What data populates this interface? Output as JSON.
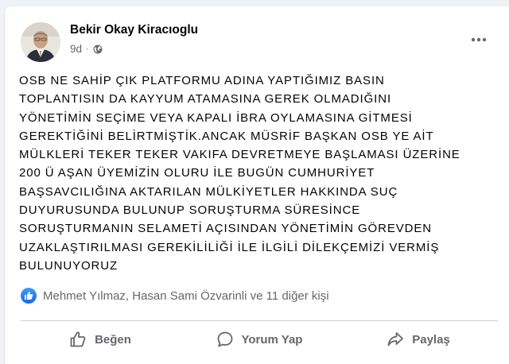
{
  "post": {
    "author_name": "Bekir Okay Kiracıoglu",
    "time": "9d",
    "dot": "·",
    "text_lines": [
      "OSB NE SAHİP ÇIK PLATFORMU ADINA YAPTIĞIMIZ BASIN",
      "TOPLANTISIN DA KAYYUM ATAMASINA GEREK OLMADIĞINI",
      "YÖNETİMİN SEÇİME VEYA KAPALI İBRA OYLAMASINA GİTMESİ",
      "GEREKTİĞİNİ BELİRTMİŞTİK.ANCAK MÜSRİF BAŞKAN OSB YE AİT",
      "MÜLKLERİ TEKER TEKER VAKIFA DEVRETMEYE BAŞLAMASI  ÜZERİNE",
      "200 Ü AŞAN ÜYEMİZİN OLURU İLE BUGÜN CUMHURİYET",
      "BAŞSAVCILIĞINA AKTARILAN MÜLKİYETLER HAKKINDA SUÇ",
      "DUYURUSUNDA BULUNUP SORUŞTURMA SÜRESİNCE",
      "SORUŞTURMANIN SELAMETİ AÇISINDAN YÖNETİMİN GÖREVDEN",
      "UZAKLAŞTIRILMASI GEREKİLİLİĞİ  İLE İLGİLİ DİLEKÇEMİZİ VERMİŞ",
      "BULUNUYORUZ"
    ],
    "reactions_text": "Mehmet Yılmaz, Hasan Sami Özvarinli ve 11 diğer kişi"
  },
  "actions": {
    "like_label": "Beğen",
    "comment_label": "Yorum Yap",
    "share_label": "Paylaş"
  },
  "icons": {
    "privacy": "globe-icon",
    "more": "more-options-icon",
    "reaction": "like-reaction-icon",
    "like": "thumbs-up-icon",
    "comment": "comment-bubble-icon",
    "share": "share-arrow-icon"
  },
  "colors": {
    "like_blue": "#1877f2",
    "secondary_text": "#65676b",
    "primary_text": "#050505"
  }
}
